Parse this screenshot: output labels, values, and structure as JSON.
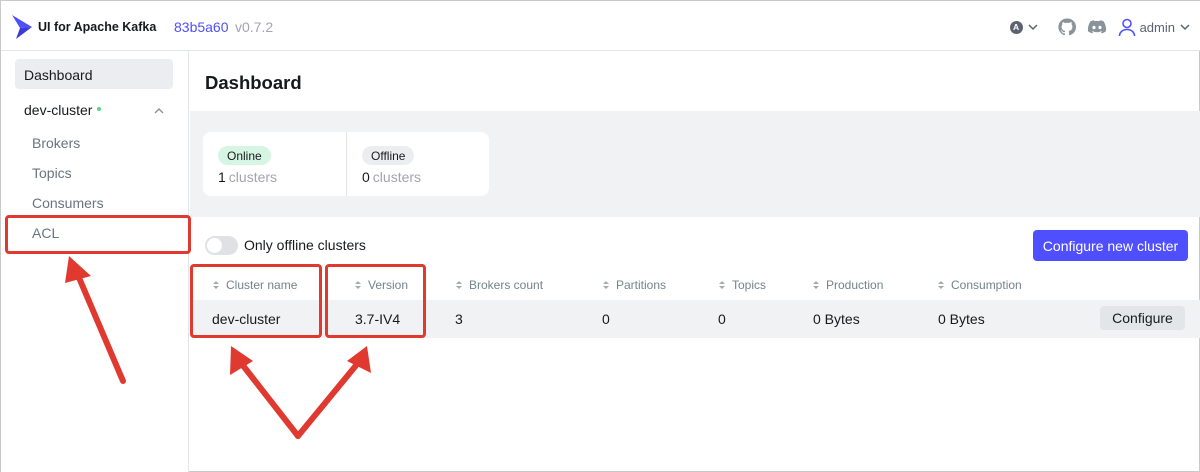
{
  "header": {
    "app_title": "UI for Apache Kafka",
    "version_hash": "83b5a60",
    "version": "v0.7.2",
    "theme_letter": "A",
    "username": "admin"
  },
  "sidebar": {
    "dashboard_label": "Dashboard",
    "cluster_name": "dev-cluster",
    "items": [
      {
        "label": "Brokers"
      },
      {
        "label": "Topics"
      },
      {
        "label": "Consumers"
      },
      {
        "label": "ACL"
      }
    ]
  },
  "main": {
    "title": "Dashboard",
    "stats": {
      "online": {
        "tag": "Online",
        "count": "1",
        "unit": "clusters"
      },
      "offline": {
        "tag": "Offline",
        "count": "0",
        "unit": "clusters"
      }
    },
    "toggle_label": "Only offline clusters",
    "configure_new_label": "Configure new cluster",
    "table": {
      "columns": [
        "Cluster name",
        "Version",
        "Brokers count",
        "Partitions",
        "Topics",
        "Production",
        "Consumption"
      ],
      "rows": [
        {
          "name": "dev-cluster",
          "version": "3.7-IV4",
          "brokers": "3",
          "partitions": "0",
          "topics": "0",
          "production": "0 Bytes",
          "consumption": "0 Bytes",
          "action": "Configure"
        }
      ]
    }
  },
  "colors": {
    "accent": "#4f4fff",
    "annotation": "#e0392f",
    "online_tag": "#d6f5e3",
    "status_dot": "#5ad38c"
  }
}
